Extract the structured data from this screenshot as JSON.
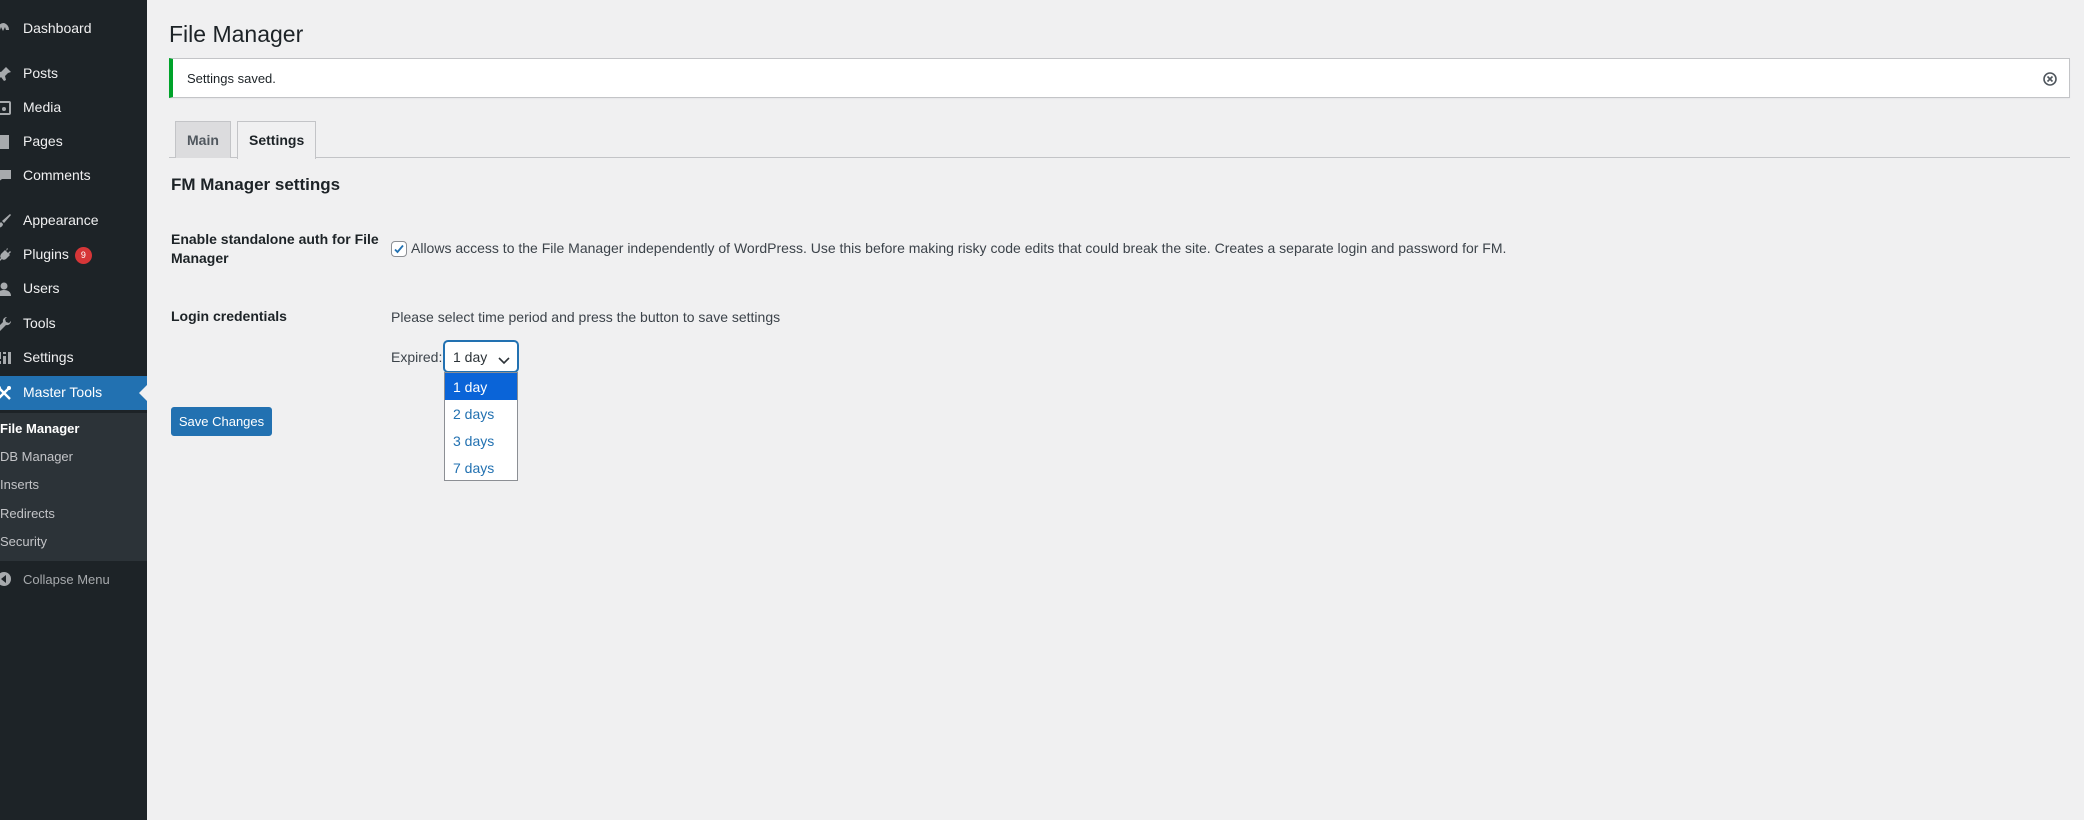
{
  "sidebar": {
    "items": [
      {
        "label": "Dashboard",
        "icon": "dashboard-icon"
      },
      {
        "label": "Posts",
        "icon": "pin-icon"
      },
      {
        "label": "Media",
        "icon": "media-icon"
      },
      {
        "label": "Pages",
        "icon": "page-icon"
      },
      {
        "label": "Comments",
        "icon": "comment-icon"
      },
      {
        "label": "Appearance",
        "icon": "brush-icon"
      },
      {
        "label": "Plugins",
        "icon": "plug-icon",
        "badge": "9"
      },
      {
        "label": "Users",
        "icon": "user-icon"
      },
      {
        "label": "Tools",
        "icon": "wrench-icon"
      },
      {
        "label": "Settings",
        "icon": "sliders-icon"
      },
      {
        "label": "Master Tools",
        "icon": "tools-icon",
        "active": true
      }
    ],
    "submenu": [
      "File Manager",
      "DB Manager",
      "Inserts",
      "Redirects",
      "Security"
    ],
    "collapse_label": "Collapse Menu"
  },
  "page": {
    "title": "File Manager",
    "notice": "Settings saved.",
    "tabs": [
      "Main",
      "Settings"
    ],
    "active_tab": "Settings",
    "section_title": "FM Manager settings"
  },
  "form": {
    "standalone_label": "Enable standalone auth for File Manager",
    "standalone_checked": true,
    "standalone_desc": "Allows access to the File Manager independently of WordPress. Use this before making risky code edits that could break the site. Creates a separate login and password for FM.",
    "credentials_label": "Login credentials",
    "credentials_desc": "Please select time period and press the button to save settings",
    "expired_label": "Expired:",
    "expired_value": "1 day",
    "expired_options": [
      "1 day",
      "2 days",
      "3 days",
      "7 days"
    ],
    "save_label": "Save Changes"
  },
  "colors": {
    "sidebar_bg": "#1d2327",
    "accent": "#2271b1",
    "success": "#00a32a",
    "badge": "#d63638"
  }
}
